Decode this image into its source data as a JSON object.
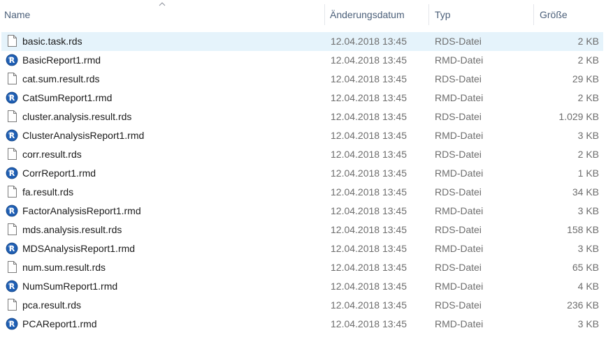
{
  "header": {
    "name": "Name",
    "date": "Änderungsdatum",
    "type": "Typ",
    "size": "Größe"
  },
  "files": [
    {
      "name": "basic.task.rds",
      "date": "12.04.2018 13:45",
      "type": "RDS-Datei",
      "size": "2 KB",
      "icon": "document-icon",
      "selected": true
    },
    {
      "name": "BasicReport1.rmd",
      "date": "12.04.2018 13:45",
      "type": "RMD-Datei",
      "size": "2 KB",
      "icon": "r-icon"
    },
    {
      "name": "cat.sum.result.rds",
      "date": "12.04.2018 13:45",
      "type": "RDS-Datei",
      "size": "29 KB",
      "icon": "document-icon"
    },
    {
      "name": "CatSumReport1.rmd",
      "date": "12.04.2018 13:45",
      "type": "RMD-Datei",
      "size": "2 KB",
      "icon": "r-icon"
    },
    {
      "name": "cluster.analysis.result.rds",
      "date": "12.04.2018 13:45",
      "type": "RDS-Datei",
      "size": "1.029 KB",
      "icon": "document-icon"
    },
    {
      "name": "ClusterAnalysisReport1.rmd",
      "date": "12.04.2018 13:45",
      "type": "RMD-Datei",
      "size": "3 KB",
      "icon": "r-icon"
    },
    {
      "name": "corr.result.rds",
      "date": "12.04.2018 13:45",
      "type": "RDS-Datei",
      "size": "2 KB",
      "icon": "document-icon"
    },
    {
      "name": "CorrReport1.rmd",
      "date": "12.04.2018 13:45",
      "type": "RMD-Datei",
      "size": "1 KB",
      "icon": "r-icon"
    },
    {
      "name": "fa.result.rds",
      "date": "12.04.2018 13:45",
      "type": "RDS-Datei",
      "size": "34 KB",
      "icon": "document-icon"
    },
    {
      "name": "FactorAnalysisReport1.rmd",
      "date": "12.04.2018 13:45",
      "type": "RMD-Datei",
      "size": "3 KB",
      "icon": "r-icon"
    },
    {
      "name": "mds.analysis.result.rds",
      "date": "12.04.2018 13:45",
      "type": "RDS-Datei",
      "size": "158 KB",
      "icon": "document-icon"
    },
    {
      "name": "MDSAnalysisReport1.rmd",
      "date": "12.04.2018 13:45",
      "type": "RMD-Datei",
      "size": "3 KB",
      "icon": "r-icon"
    },
    {
      "name": "num.sum.result.rds",
      "date": "12.04.2018 13:45",
      "type": "RDS-Datei",
      "size": "65 KB",
      "icon": "document-icon"
    },
    {
      "name": "NumSumReport1.rmd",
      "date": "12.04.2018 13:45",
      "type": "RMD-Datei",
      "size": "4 KB",
      "icon": "r-icon"
    },
    {
      "name": "pca.result.rds",
      "date": "12.04.2018 13:45",
      "type": "RDS-Datei",
      "size": "236 KB",
      "icon": "document-icon"
    },
    {
      "name": "PCAReport1.rmd",
      "date": "12.04.2018 13:45",
      "type": "RMD-Datei",
      "size": "3 KB",
      "icon": "r-icon"
    }
  ],
  "colors": {
    "selection": "#e5f3fb",
    "header_text": "#4c607a",
    "r_icon_blue": "#1f5fb4"
  }
}
